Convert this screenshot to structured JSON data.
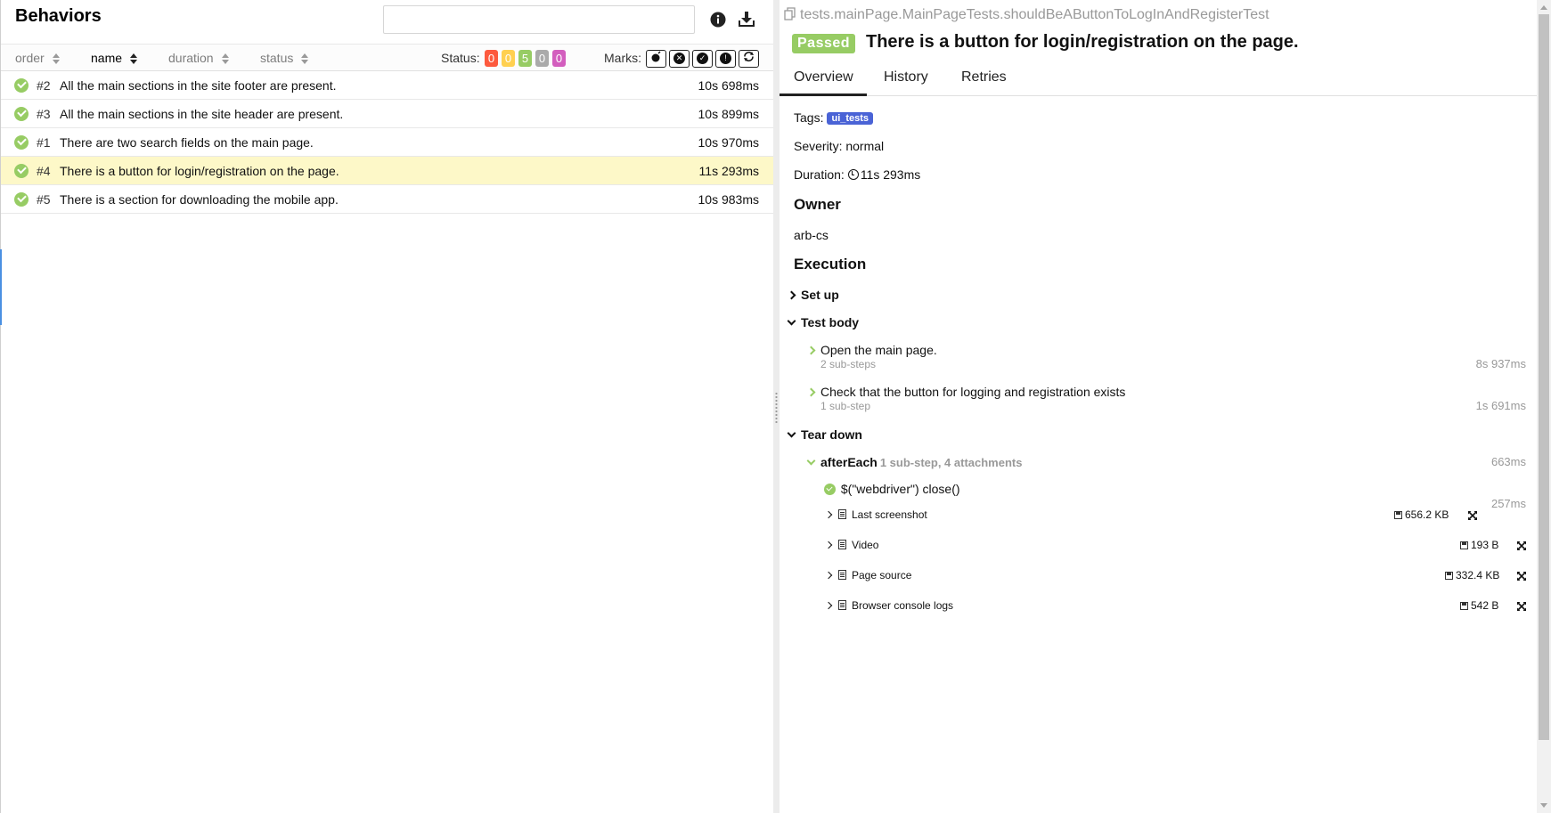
{
  "behaviors": {
    "title": "Behaviors",
    "search": {
      "value": "",
      "placeholder": ""
    },
    "info_icon": "info-icon",
    "download_icon": "download-icon",
    "sort_columns": [
      {
        "key": "order",
        "label": "order",
        "active": false
      },
      {
        "key": "name",
        "label": "name",
        "active": true
      },
      {
        "key": "duration",
        "label": "duration",
        "active": false
      },
      {
        "key": "status",
        "label": "status",
        "active": false
      }
    ],
    "status_filter": {
      "label": "Status:",
      "counts": [
        {
          "name": "failed",
          "value": "0",
          "color": "#fd5a3e"
        },
        {
          "name": "broken",
          "value": "0",
          "color": "#ffd050"
        },
        {
          "name": "passed",
          "value": "5",
          "color": "#97cc64"
        },
        {
          "name": "skipped",
          "value": "0",
          "color": "#aaaaaa"
        },
        {
          "name": "unknown",
          "value": "0",
          "color": "#d35ebe"
        }
      ]
    },
    "marks": {
      "label": "Marks:",
      "icons": [
        "flaky-icon",
        "new-failed-icon",
        "new-passed-icon",
        "new-broken-icon",
        "retries-icon"
      ]
    },
    "rows": [
      {
        "num": "#2",
        "title": "All the main sections in the site footer are present.",
        "duration": "10s 698ms",
        "selected": false
      },
      {
        "num": "#3",
        "title": "All the main sections in the site header are present.",
        "duration": "10s 899ms",
        "selected": false
      },
      {
        "num": "#1",
        "title": "There are two search fields on the main page.",
        "duration": "10s 970ms",
        "selected": false
      },
      {
        "num": "#4",
        "title": "There is a button for login/registration on the page.",
        "duration": "11s 293ms",
        "selected": true
      },
      {
        "num": "#5",
        "title": "There is a section for downloading the mobile app.",
        "duration": "10s 983ms",
        "selected": false
      }
    ]
  },
  "detail": {
    "full_name": "tests.mainPage.MainPageTests.shouldBeAButtonToLogInAndRegisterTest",
    "status": "Passed",
    "status_color": "#97cc64",
    "title": "There is a button for login/registration on the page.",
    "tabs": [
      "Overview",
      "History",
      "Retries"
    ],
    "active_tab": "Overview",
    "tags_label": "Tags:",
    "tag": "ui_tests",
    "severity": "Severity: normal",
    "duration_label": "Duration:",
    "duration": "11s 293ms",
    "owner_heading": "Owner",
    "owner": "arb-cs",
    "execution_heading": "Execution",
    "set_up": "Set up",
    "test_body": "Test body",
    "steps": [
      {
        "name": "Open the main page.",
        "sub": "2 sub-steps",
        "time": "8s 937ms"
      },
      {
        "name": "Check that the button for logging and registration exists",
        "sub": "1 sub-step",
        "time": "1s 691ms"
      }
    ],
    "tear_down": "Tear down",
    "after_each": {
      "name": "afterEach",
      "meta": "1 sub-step, 4 attachments",
      "time": "663ms"
    },
    "substep": {
      "name": "$(\"webdriver\") close()",
      "time": "257ms"
    },
    "attachments": [
      {
        "name": "Last screenshot",
        "size": "656.2 KB",
        "icon": "image-file-icon"
      },
      {
        "name": "Video",
        "size": "193 B",
        "icon": "video-file-icon"
      },
      {
        "name": "Page source",
        "size": "332.4 KB",
        "icon": "text-file-icon"
      },
      {
        "name": "Browser console logs",
        "size": "542 B",
        "icon": "text-file-icon"
      }
    ]
  }
}
